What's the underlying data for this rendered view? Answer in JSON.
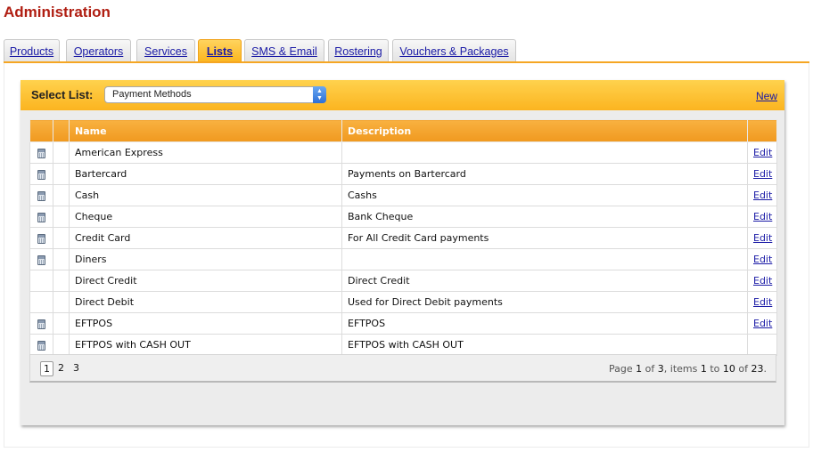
{
  "page": {
    "title": "Administration"
  },
  "tabs": [
    {
      "label": "Products"
    },
    {
      "label": "Operators"
    },
    {
      "label": "Services"
    },
    {
      "label": "Lists",
      "active": true
    },
    {
      "label": "SMS & Email"
    },
    {
      "label": "Rostering"
    },
    {
      "label": "Vouchers & Packages"
    }
  ],
  "toolbar": {
    "select_label": "Select List:",
    "selected_value": "Payment Methods",
    "new_label": "New"
  },
  "table": {
    "columns": {
      "name": "Name",
      "description": "Description"
    },
    "rows": [
      {
        "icon": "calculator-icon",
        "name": "American Express",
        "description": "",
        "edit": "Edit"
      },
      {
        "icon": "calculator-icon",
        "name": "Bartercard",
        "description": "Payments on Bartercard",
        "edit": "Edit"
      },
      {
        "icon": "calculator-icon",
        "name": "Cash",
        "description": "Cashs",
        "edit": "Edit"
      },
      {
        "icon": "calculator-icon",
        "name": "Cheque",
        "description": "Bank Cheque",
        "edit": "Edit"
      },
      {
        "icon": "calculator-icon",
        "name": "Credit Card",
        "description": "For All Credit Card payments",
        "edit": "Edit"
      },
      {
        "icon": "calculator-icon",
        "name": "Diners",
        "description": "",
        "edit": "Edit"
      },
      {
        "icon": "",
        "name": "Direct Credit",
        "description": "Direct Credit",
        "edit": "Edit"
      },
      {
        "icon": "",
        "name": "Direct Debit",
        "description": "Used for Direct Debit payments",
        "edit": "Edit"
      },
      {
        "icon": "calculator-icon",
        "name": "EFTPOS",
        "description": "EFTPOS",
        "edit": "Edit"
      },
      {
        "icon": "calculator-icon",
        "name": "EFTPOS with CASH OUT",
        "description": "EFTPOS with CASH OUT",
        "edit": ""
      }
    ]
  },
  "pager": {
    "pages": [
      "1",
      "2",
      "3"
    ],
    "current_page": "1",
    "summary": {
      "prefix": "Page ",
      "page": "1",
      "of": " of ",
      "total_pages": "3",
      "items_word": ", items ",
      "from": "1",
      "to_word": " to ",
      "to": "10",
      "of2": " of ",
      "total_items": "23",
      "suffix": "."
    }
  },
  "colors": {
    "title": "#b01e12",
    "accent": "#f5a623",
    "link": "#1a1aa6"
  }
}
